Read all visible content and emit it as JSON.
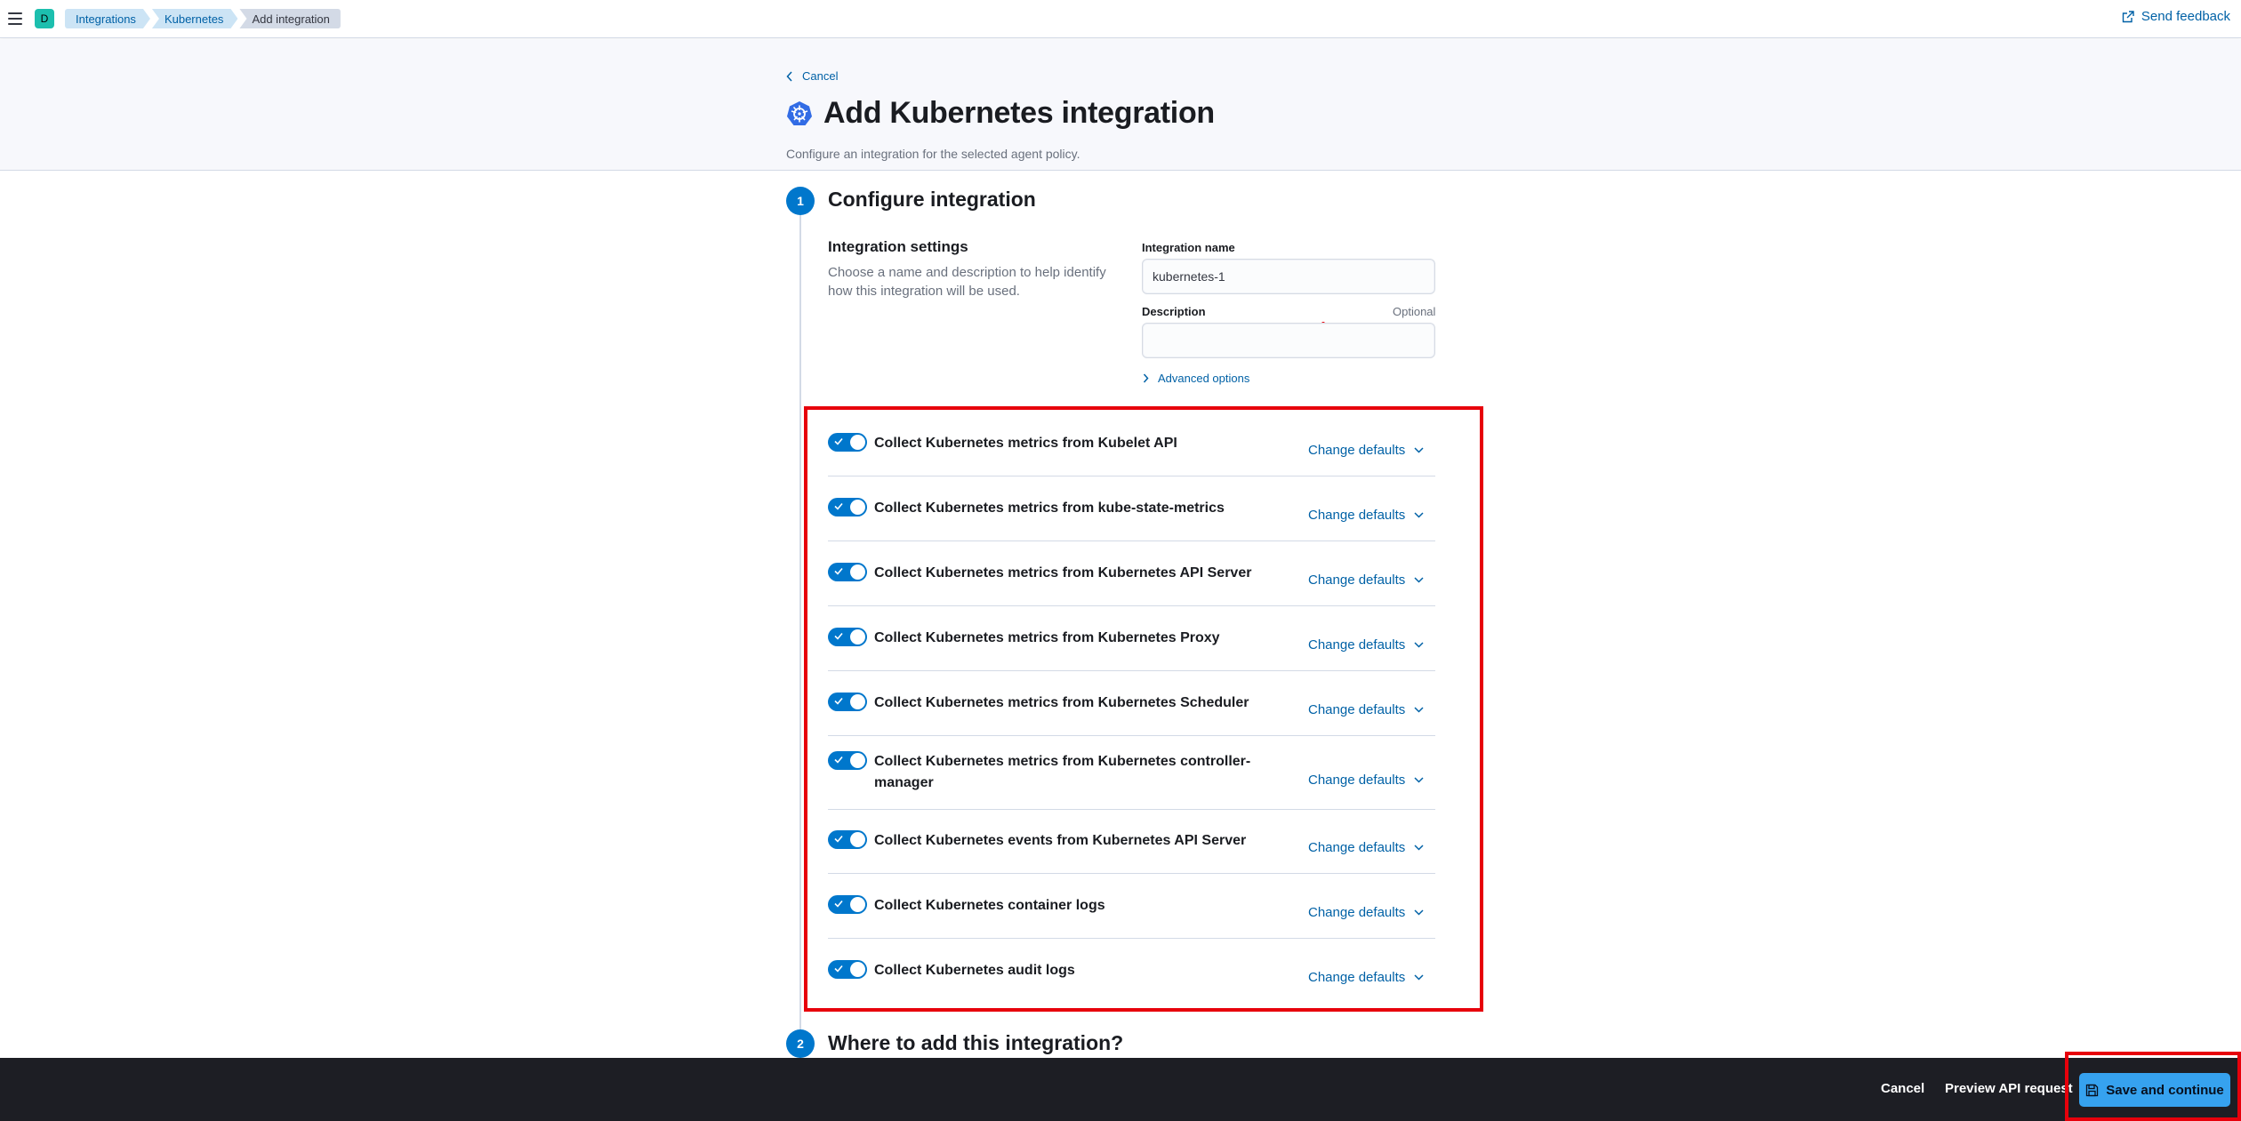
{
  "header": {
    "space_initial": "D",
    "breadcrumbs": [
      "Integrations",
      "Kubernetes",
      "Add integration"
    ],
    "send_feedback": "Send feedback"
  },
  "page": {
    "cancel": "Cancel",
    "title": "Add Kubernetes integration",
    "description": "Configure an integration for the selected agent policy."
  },
  "step1": {
    "number": "1",
    "title": "Configure integration",
    "settings_title": "Integration settings",
    "settings_desc": "Choose a name and description to help identify how this integration will be used.",
    "name_label": "Integration name",
    "name_value": "kubernetes-1",
    "description_label": "Description",
    "description_optional": "Optional",
    "description_value": "",
    "advanced_options": "Advanced options"
  },
  "inputs": {
    "change_defaults": "Change defaults",
    "items": [
      {
        "label": "Collect Kubernetes metrics from Kubelet API",
        "enabled": true
      },
      {
        "label": "Collect Kubernetes metrics from kube-state-metrics",
        "enabled": true
      },
      {
        "label": "Collect Kubernetes metrics from Kubernetes API Server",
        "enabled": true
      },
      {
        "label": "Collect Kubernetes metrics from Kubernetes Proxy",
        "enabled": true
      },
      {
        "label": "Collect Kubernetes metrics from Kubernetes Scheduler",
        "enabled": true
      },
      {
        "label": "Collect Kubernetes metrics from Kubernetes controller-manager",
        "enabled": true
      },
      {
        "label": "Collect Kubernetes events from Kubernetes API Server",
        "enabled": true
      },
      {
        "label": "Collect Kubernetes container logs",
        "enabled": true
      },
      {
        "label": "Collect Kubernetes audit logs",
        "enabled": true
      }
    ]
  },
  "step2": {
    "number": "2",
    "title": "Where to add this integration?"
  },
  "footer": {
    "cancel": "Cancel",
    "preview_api": "Preview API request",
    "save": "Save and continue"
  },
  "colors": {
    "primary": "#0077cc",
    "link": "#0061a6",
    "highlight": "#e7000b",
    "footer_bg": "#1d1e24",
    "save_button": "#36a2ef"
  }
}
